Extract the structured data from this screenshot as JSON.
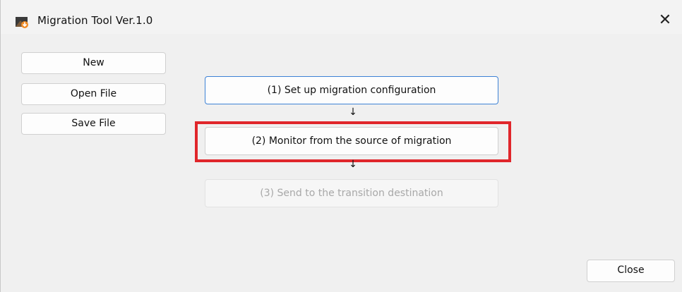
{
  "window": {
    "title": "Migration Tool Ver.1.0",
    "close_glyph": "✕",
    "app_icon": "migration-app-icon"
  },
  "sidebar": {
    "buttons": [
      {
        "label": "New"
      },
      {
        "label": "Open File"
      },
      {
        "label": "Save File"
      }
    ]
  },
  "steps": [
    {
      "label": "(1) Set up migration configuration",
      "state": "focused"
    },
    {
      "label": "(2) Monitor from the source of migration",
      "state": "highlighted"
    },
    {
      "label": "(3) Send to the transition destination",
      "state": "disabled"
    }
  ],
  "arrows": {
    "glyph": "↓"
  },
  "footer": {
    "close_label": "Close"
  },
  "colors": {
    "highlight": "#e0262b",
    "focus_border": "#3d82d6",
    "window_bg": "#f0f0f0"
  }
}
